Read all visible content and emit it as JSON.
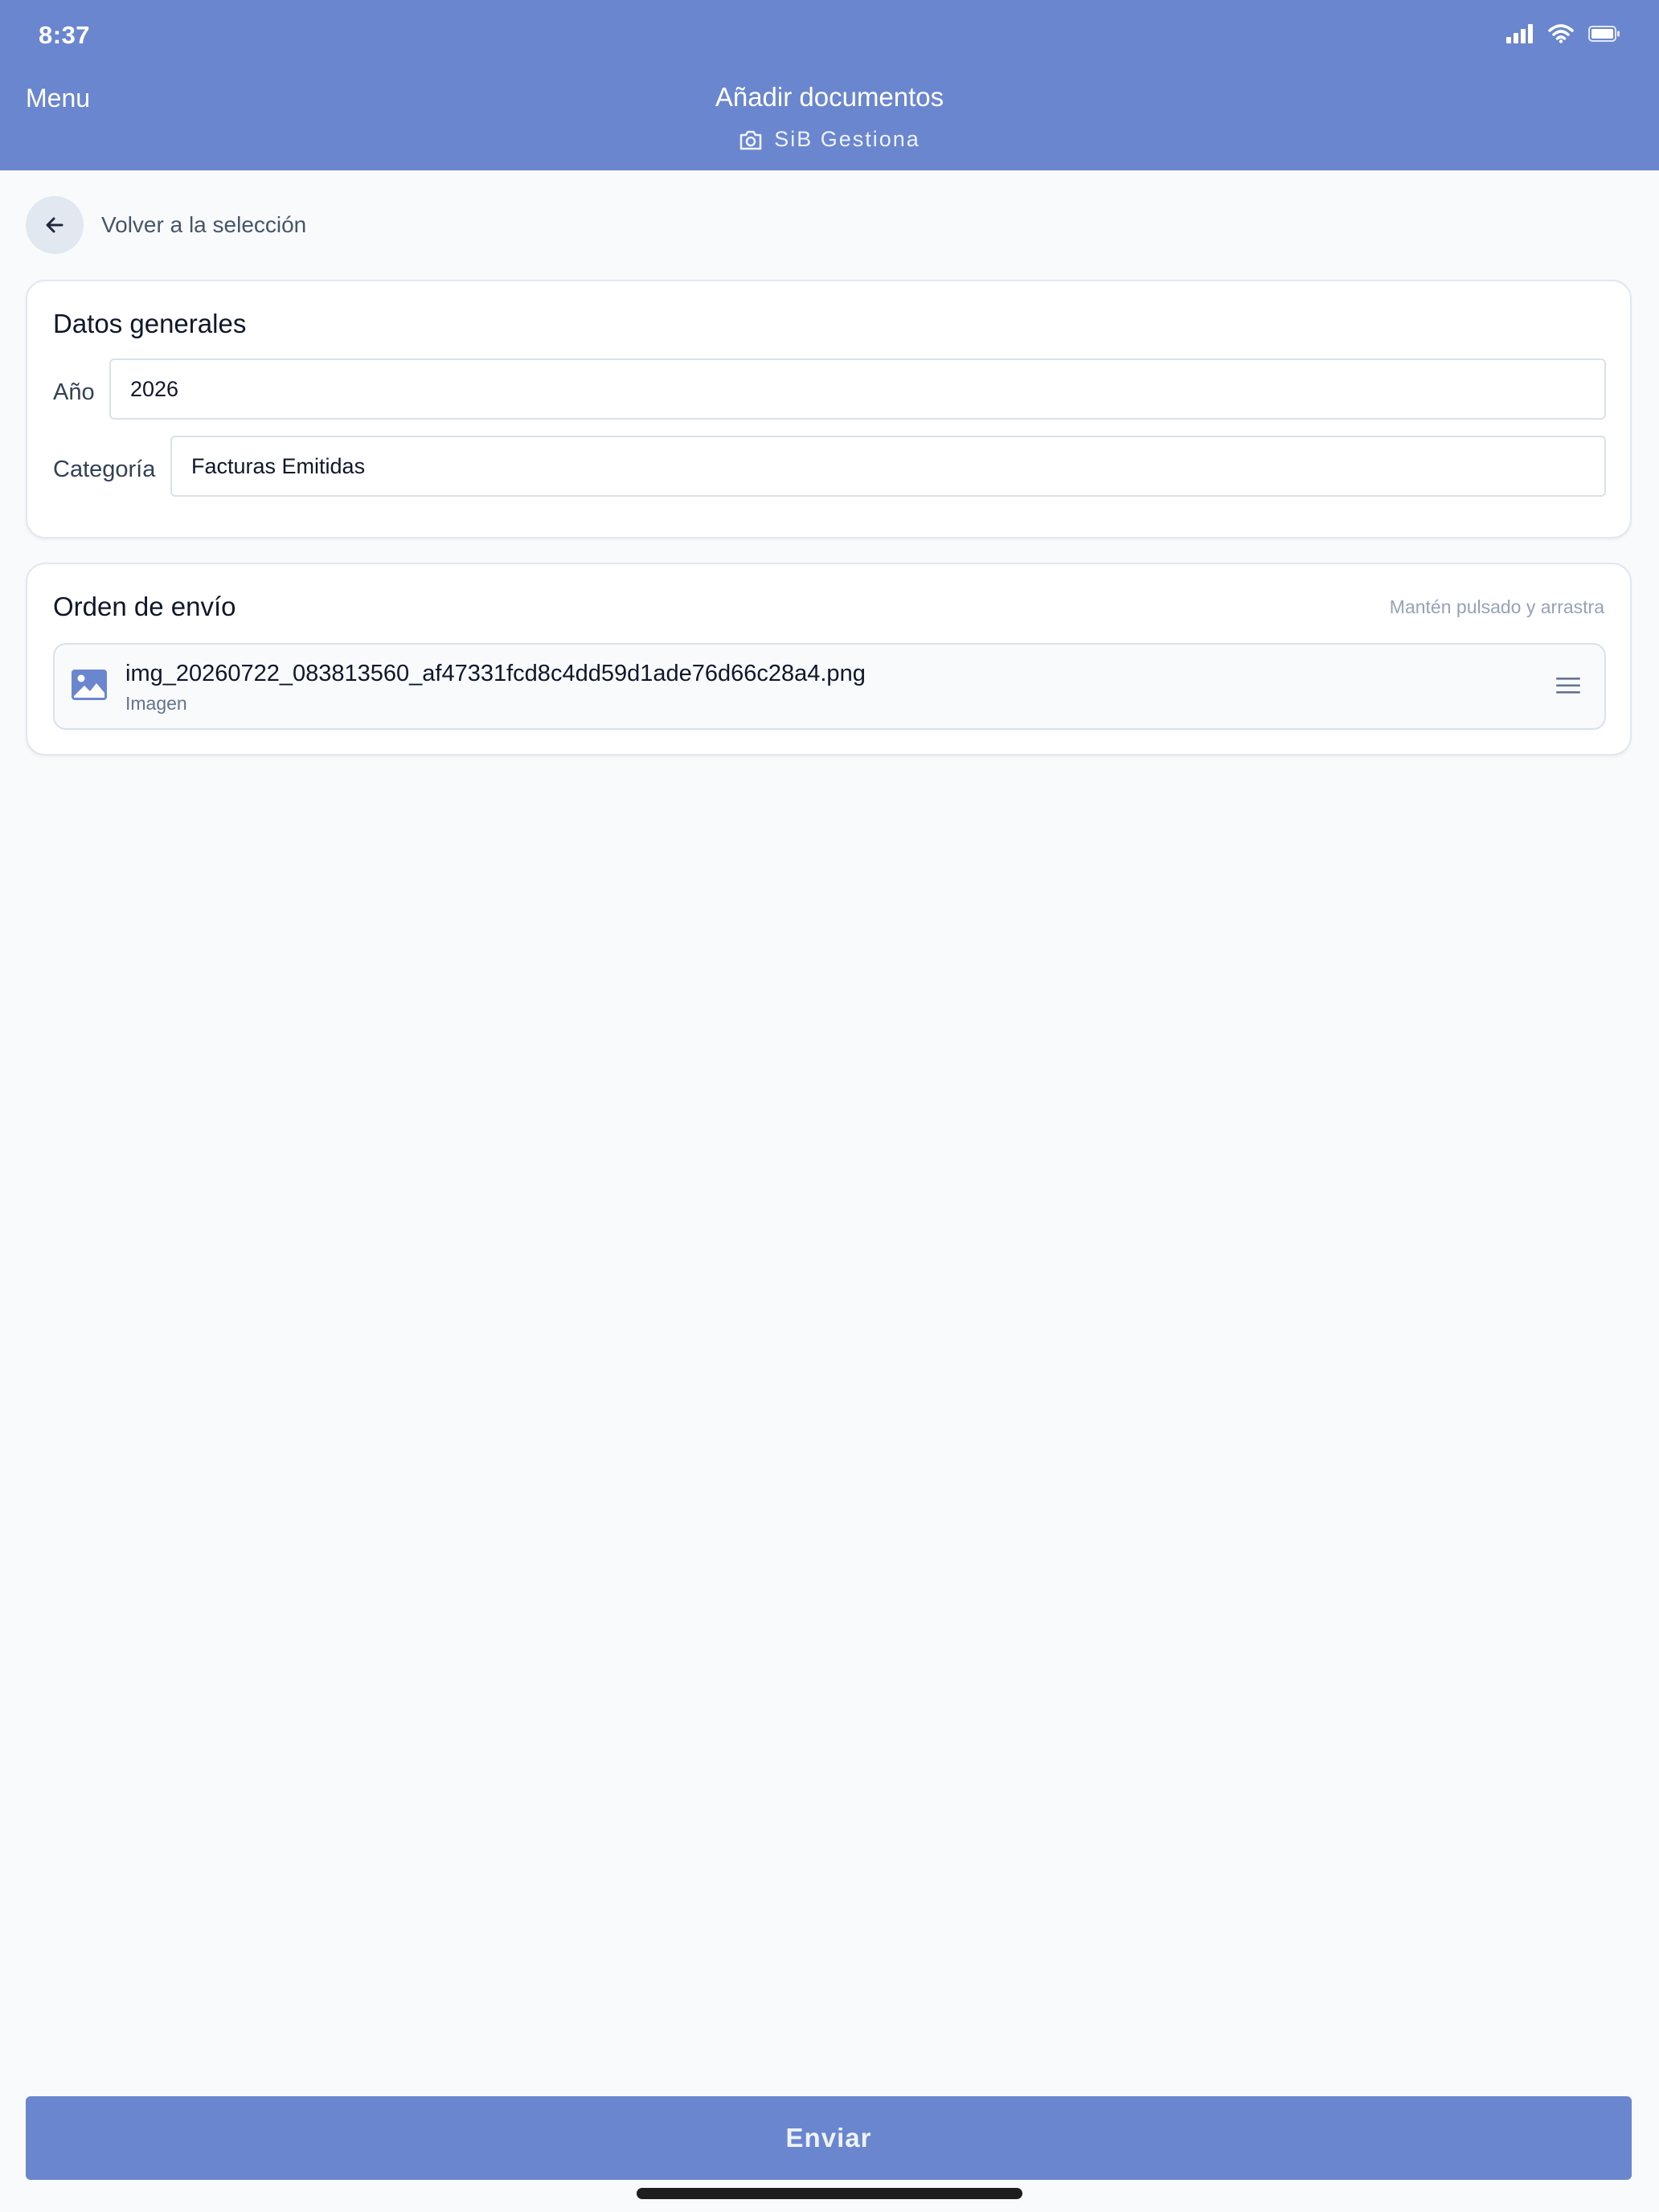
{
  "status_bar": {
    "time": "8:37"
  },
  "header": {
    "menu_label": "Menu",
    "title": "Añadir documentos",
    "subtitle": "SiB Gestiona",
    "color": "#6a86cf"
  },
  "back": {
    "label": "Volver a la selección"
  },
  "general": {
    "title": "Datos generales",
    "year_label": "Año",
    "year_value": "2026",
    "category_label": "Categoría",
    "category_value": "Facturas Emitidas"
  },
  "order": {
    "title": "Orden de envío",
    "hint": "Mantén pulsado y arrastra",
    "documents": [
      {
        "name": "img_20260722_083813560_af47331fcd8c4dd59d1ade76d66c28a4.png",
        "type": "Imagen"
      }
    ]
  },
  "submit": {
    "label": "Enviar"
  },
  "icons": {
    "signal": "signal-icon",
    "wifi": "wifi-icon",
    "battery": "battery-icon",
    "camera": "camera-icon",
    "back": "arrow-left-icon",
    "image": "image-icon",
    "drag": "drag-handle-icon"
  }
}
